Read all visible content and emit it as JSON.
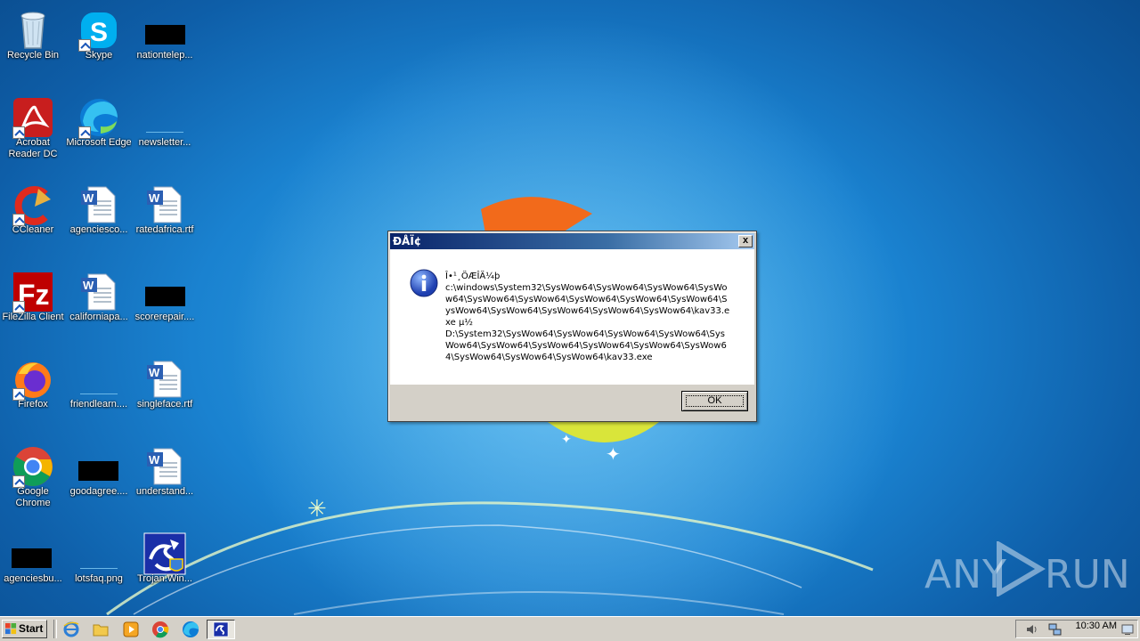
{
  "desktop": {
    "icons": [
      {
        "label": "Recycle Bin"
      },
      {
        "label": "Skype"
      },
      {
        "label": "nationtelep..."
      },
      {
        "label": "Acrobat Reader DC"
      },
      {
        "label": "Microsoft Edge"
      },
      {
        "label": "newsletter..."
      },
      {
        "label": "CCleaner"
      },
      {
        "label": "agenciesco..."
      },
      {
        "label": "ratedafrica.rtf"
      },
      {
        "label": "FileZilla Client"
      },
      {
        "label": "californiapa..."
      },
      {
        "label": "scorerepair...."
      },
      {
        "label": "Firefox"
      },
      {
        "label": "friendlearn...."
      },
      {
        "label": "singleface.rtf"
      },
      {
        "label": "Google Chrome"
      },
      {
        "label": "goodagree...."
      },
      {
        "label": "understand..."
      },
      {
        "label": "agenciesbu..."
      },
      {
        "label": "lotsfaq.png"
      },
      {
        "label": "Trojan.Win..."
      }
    ]
  },
  "dialog": {
    "title": "ÐÅÏ¢",
    "close_label": "x",
    "icon": "info-icon",
    "message": "Î•¹¸ÖÆÎÄ¼þ\nc:\\windows\\System32\\SysWow64\\SysWow64\\SysWow64\\SysWow64\\SysWow64\\SysWow64\\SysWow64\\SysWow64\\SysWow64\\SysWow64\\SysWow64\\SysWow64\\SysWow64\\SysWow64\\kav33.exe µ½\nD:\\System32\\SysWow64\\SysWow64\\SysWow64\\SysWow64\\SysWow64\\SysWow64\\SysWow64\\SysWow64\\SysWow64\\SysWow64\\SysWow64\\SysWow64\\SysWow64\\kav33.exe",
    "ok_label": "OK"
  },
  "taskbar": {
    "start_label": "Start",
    "quicklaunch": [
      "ie-icon",
      "explorer-icon",
      "media-player-icon",
      "chrome-icon",
      "edge-icon"
    ],
    "active_task_icon": "trojan-app-icon",
    "clock": "10:30 AM"
  },
  "watermark": {
    "left": "ANY",
    "right": "RUN"
  }
}
